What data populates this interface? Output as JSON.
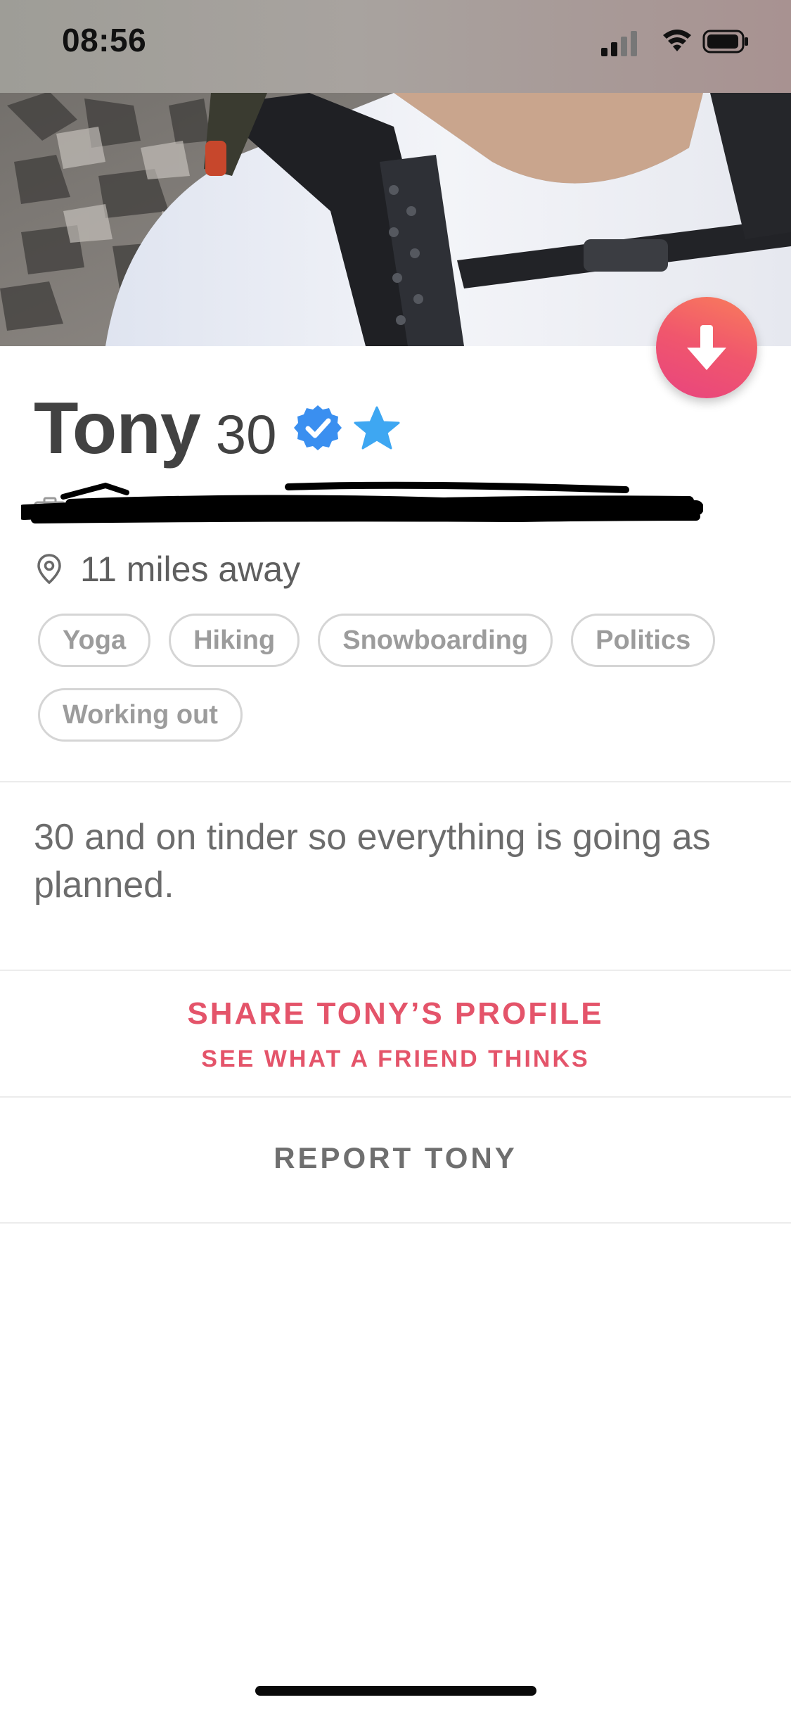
{
  "status_bar": {
    "time": "08:56",
    "signal_icon": "cellular-signal-icon",
    "wifi_icon": "wifi-icon",
    "battery_icon": "battery-icon"
  },
  "photo": {
    "description_icon": "profile-photo"
  },
  "collapse_button": {
    "icon": "arrow-down-icon",
    "colors": [
      "#f97d5b",
      "#f0566d",
      "#e8447f"
    ]
  },
  "profile": {
    "name": "Tony",
    "age": "30",
    "verified_icon": "verified-badge-icon",
    "star_icon": "star-icon",
    "job_icon": "briefcase-icon",
    "distance_icon": "location-pin-icon",
    "distance": "11 miles away"
  },
  "interests": [
    "Yoga",
    "Hiking",
    "Snowboarding",
    "Politics",
    "Working out"
  ],
  "bio": "30 and on tinder so everything is going as planned.",
  "share": {
    "title": "SHARE TONY’S PROFILE",
    "subtitle": "SEE WHAT A FRIEND THINKS"
  },
  "report": {
    "label": "REPORT TONY"
  },
  "colors": {
    "accent": "#e4546a",
    "verified_blue": "#3a8ff0",
    "star_blue": "#3ea7f2",
    "text_dark": "#424242",
    "text_gray": "#6c6c6c"
  }
}
